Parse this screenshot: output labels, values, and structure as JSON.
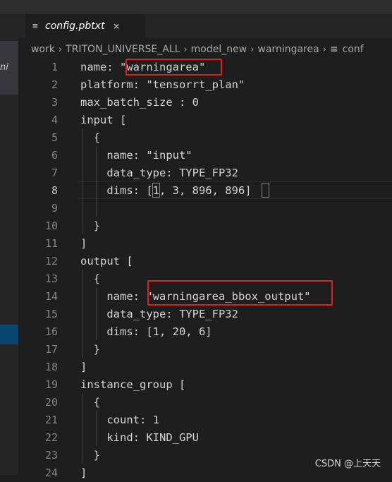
{
  "sidebar": {
    "item_text": "ni"
  },
  "tab": {
    "icon": "lines-icon",
    "label": "config.pbtxt",
    "close": "×"
  },
  "breadcrumb": [
    {
      "label": "work"
    },
    {
      "label": "TRITON_UNIVERSE_ALL"
    },
    {
      "label": "model_new"
    },
    {
      "label": "warningarea"
    },
    {
      "label": "conf",
      "icon": "≡"
    }
  ],
  "breadcrumb_sep": "›",
  "editor": {
    "lines": [
      {
        "n": "1",
        "text": "name: \"warningarea\""
      },
      {
        "n": "2",
        "text": "platform: \"tensorrt_plan\""
      },
      {
        "n": "3",
        "text": "max_batch_size : 0"
      },
      {
        "n": "4",
        "text": "input ["
      },
      {
        "n": "5",
        "text": "  {"
      },
      {
        "n": "6",
        "text": "    name: \"input\""
      },
      {
        "n": "7",
        "text": "    data_type: TYPE_FP32"
      },
      {
        "n": "8",
        "text": "    dims: [1, 3, 896, 896]"
      },
      {
        "n": "9",
        "text": ""
      },
      {
        "n": "10",
        "text": "  }"
      },
      {
        "n": "11",
        "text": "]"
      },
      {
        "n": "12",
        "text": "output ["
      },
      {
        "n": "13",
        "text": "  {"
      },
      {
        "n": "14",
        "text": "    name: \"warningarea_bbox_output\""
      },
      {
        "n": "15",
        "text": "    data_type: TYPE_FP32"
      },
      {
        "n": "16",
        "text": "    dims: [1, 20, 6]"
      },
      {
        "n": "17",
        "text": "  }"
      },
      {
        "n": "18",
        "text": "]"
      },
      {
        "n": "19",
        "text": "instance_group ["
      },
      {
        "n": "20",
        "text": "  {"
      },
      {
        "n": "21",
        "text": "    count: 1"
      },
      {
        "n": "22",
        "text": "    kind: KIND_GPU"
      },
      {
        "n": "23",
        "text": "  }"
      },
      {
        "n": "24",
        "text": "]"
      }
    ],
    "active_line": "8"
  },
  "watermark": "CSDN @上天天",
  "colors": {
    "highlight_box": "#e51c1c",
    "selected_sidebar": "#094771"
  }
}
